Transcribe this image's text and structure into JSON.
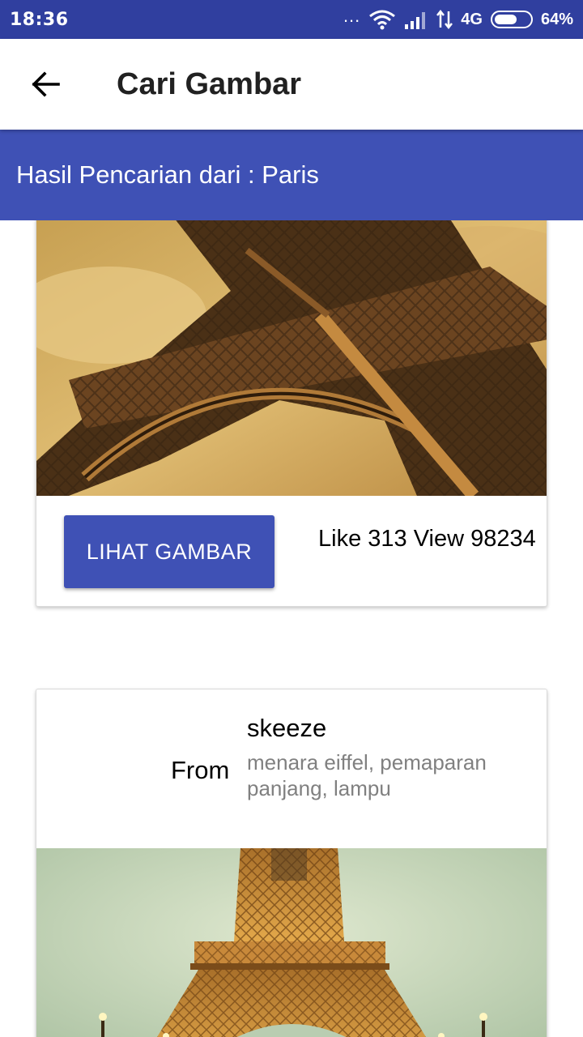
{
  "status_bar": {
    "time": "18:36",
    "dots": "...",
    "network": "4G",
    "battery_level": 0.64,
    "battery_text": "64%"
  },
  "toolbar": {
    "back_icon": "arrow-left-icon",
    "title": "Cari Gambar"
  },
  "subheader": {
    "text": "Hasil Pencarian dari : Paris"
  },
  "colors": {
    "status_bar": "#303F9F",
    "primary": "#3F51B5",
    "secondary_text": "#808080"
  },
  "results": [
    {
      "image": "eiffel-tower-sepia-photo",
      "button_label": "LIHAT GAMBAR",
      "stats": "Like 313  View 98234"
    },
    {
      "from_label": "From",
      "author": "skeeze",
      "tags": "menara eiffel, pemaparan panjang, lampu",
      "image": "eiffel-tower-night-lights-photo"
    }
  ]
}
